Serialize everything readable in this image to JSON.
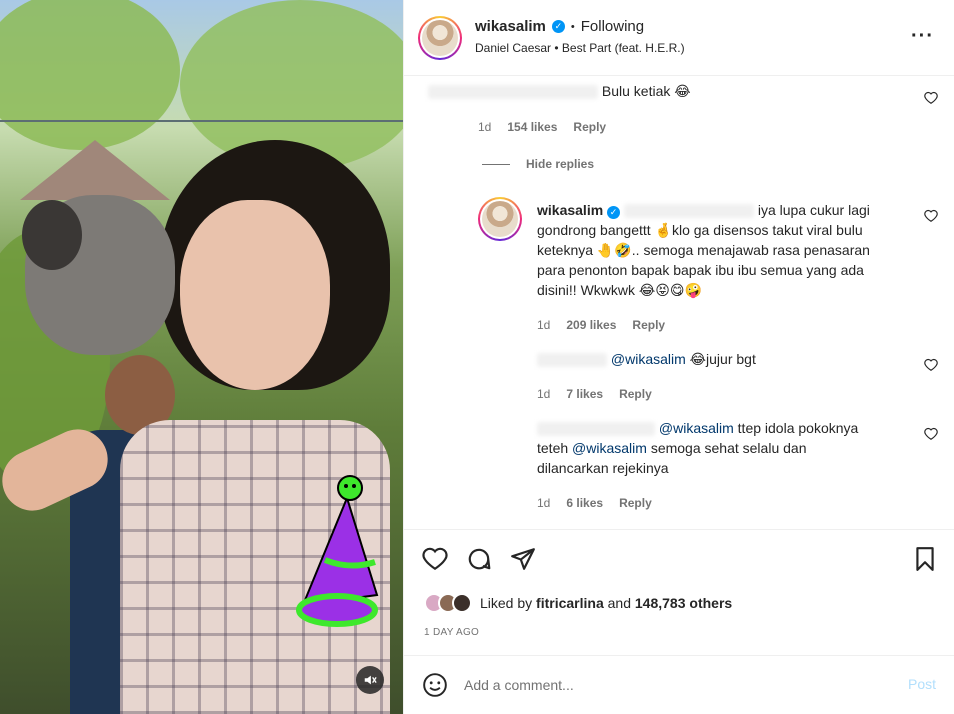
{
  "header": {
    "username": "wikasalim",
    "separator": "•",
    "follow_status": "Following",
    "music": "Daniel Caesar • Best Part (feat. H.E.R.)",
    "more_icon": "more-horizontal-icon"
  },
  "comments": [
    {
      "text": "Bulu ketiak 😂",
      "time": "1d",
      "likes": "154 likes",
      "reply": "Reply"
    }
  ],
  "hide_replies": "Hide replies",
  "replies": [
    {
      "username": "wikasalim",
      "text_1": "iya lupa cukur lagi",
      "text_2": "gondrong bangettt 🤞klo ga disensos takut viral bulu",
      "text_3": "keteknya 🤚🤣.. semoga menajawab rasa penasaran",
      "text_4": "para penonton bapak bapak ibu ibu semua yang ada",
      "text_5": "disini!! Wkwkwk 😂😝😋🤪",
      "time": "1d",
      "likes": "209 likes",
      "reply": "Reply"
    },
    {
      "mention": "@wikasalim",
      "text": "😂jujur bgt",
      "time": "1d",
      "likes": "7 likes",
      "reply": "Reply"
    },
    {
      "mention_1": "@wikasalim",
      "text_1": "ttep idola pokoknya",
      "text_2_prefix": "teteh",
      "mention_2": "@wikasalim",
      "text_2_suffix": "semoga sehat selalu dan",
      "text_3": "dilancarkan rejekinya",
      "time": "1d",
      "likes": "6 likes",
      "reply": "Reply"
    }
  ],
  "actions": {
    "liked_by_prefix": "Liked by",
    "liked_by_user": "fitricarlina",
    "liked_by_mid": "and",
    "liked_by_count": "148,783 others",
    "time_ago": "1 DAY AGO"
  },
  "add_comment": {
    "placeholder": "Add a comment...",
    "post": "Post"
  },
  "colors": {
    "verified": "#0095f6",
    "mention": "#00376b",
    "post_disabled": "#b2dffc",
    "hat_purple": "#9b30e6",
    "hat_green": "#3ee82c"
  }
}
